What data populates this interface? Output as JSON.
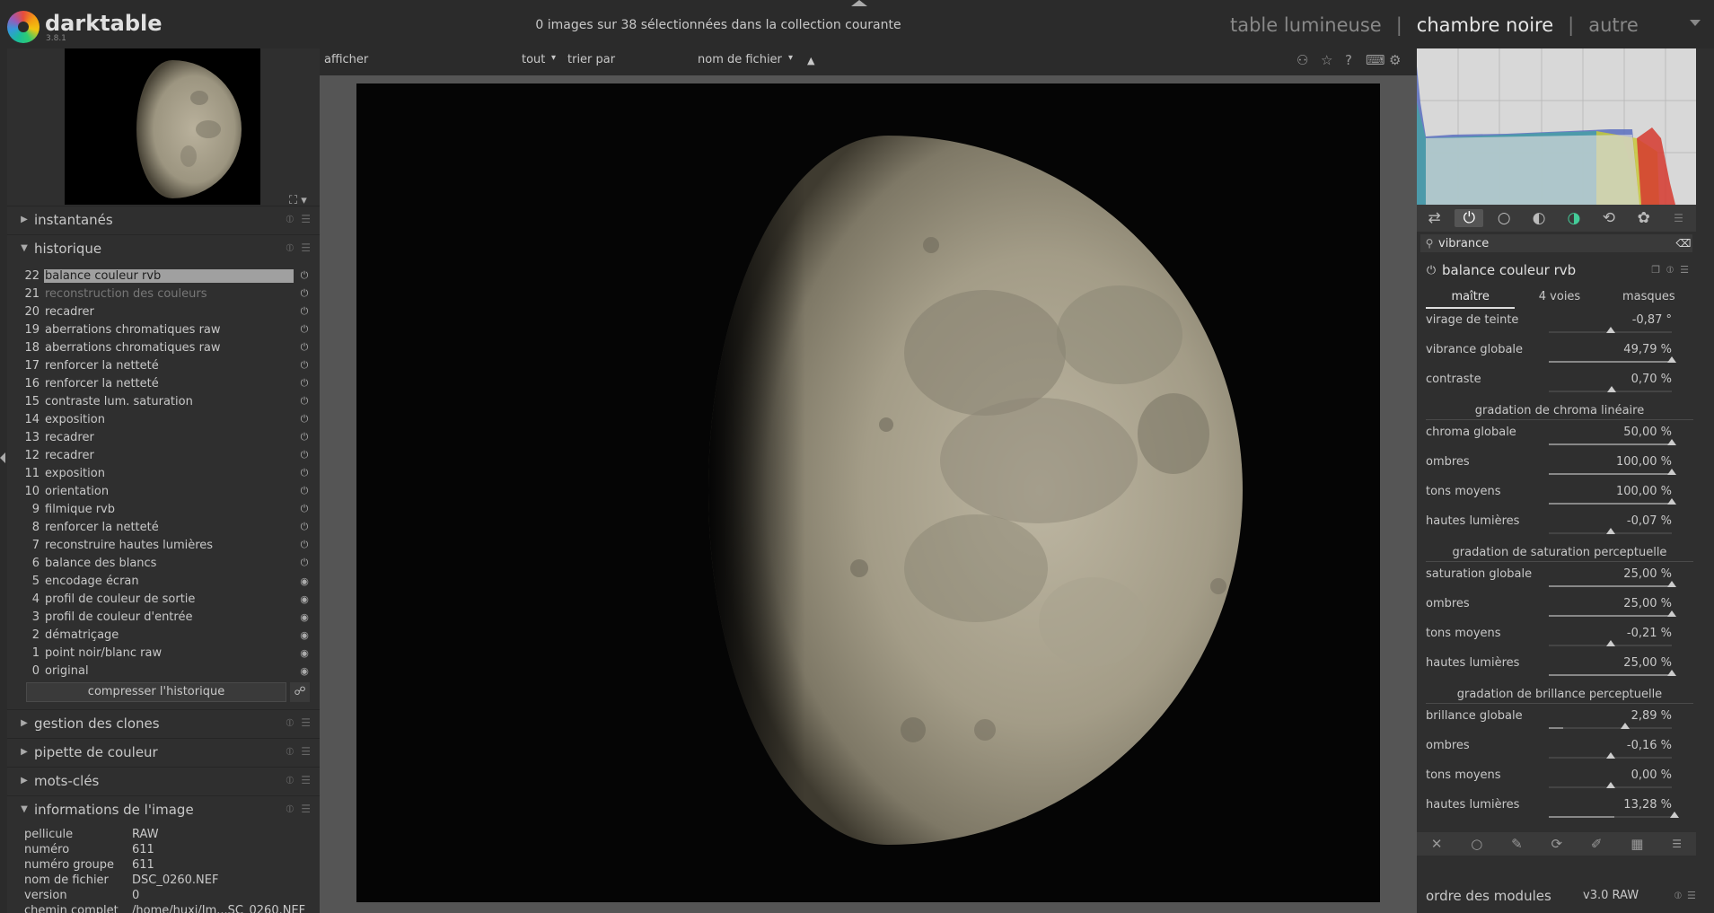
{
  "app": {
    "title": "darktable",
    "version": "3.8.1"
  },
  "header": {
    "collection_status": "0 images sur 38 sélectionnées dans la collection courante",
    "views": {
      "lighttable": "table lumineuse",
      "darkroom": "chambre noire",
      "other": "autre",
      "separator": "|"
    }
  },
  "toolbar": {
    "show_label": "afficher",
    "filter_value": "tout",
    "sort_label": "trier par",
    "sort_value": "nom de fichier",
    "sort_direction_icon": "▲",
    "dropdown_icon": "▾"
  },
  "left_panel": {
    "snapshots": {
      "label": "instantanés"
    },
    "history": {
      "label": "historique",
      "items": [
        {
          "num": "22",
          "label": "balance couleur rvb",
          "state": "selected",
          "icon": "power-icon"
        },
        {
          "num": "21",
          "label": "reconstruction des couleurs",
          "state": "disabled",
          "icon": "power-icon"
        },
        {
          "num": "20",
          "label": "recadrer",
          "state": "normal",
          "icon": "power-icon"
        },
        {
          "num": "19",
          "label": "aberrations chromatiques raw",
          "state": "normal",
          "icon": "power-icon"
        },
        {
          "num": "18",
          "label": "aberrations chromatiques raw",
          "state": "normal",
          "icon": "power-icon"
        },
        {
          "num": "17",
          "label": "renforcer la netteté",
          "state": "normal",
          "icon": "power-icon"
        },
        {
          "num": "16",
          "label": "renforcer la netteté",
          "state": "normal",
          "icon": "power-icon"
        },
        {
          "num": "15",
          "label": "contraste lum. saturation",
          "state": "normal",
          "icon": "power-icon"
        },
        {
          "num": "14",
          "label": "exposition",
          "state": "normal",
          "icon": "power-icon"
        },
        {
          "num": "13",
          "label": "recadrer",
          "state": "normal",
          "icon": "power-icon"
        },
        {
          "num": "12",
          "label": "recadrer",
          "state": "normal",
          "icon": "power-icon"
        },
        {
          "num": "11",
          "label": "exposition",
          "state": "normal",
          "icon": "power-icon"
        },
        {
          "num": "10",
          "label": "orientation",
          "state": "normal",
          "icon": "power-icon"
        },
        {
          "num": "9",
          "label": "filmique rvb",
          "state": "normal",
          "icon": "power-icon"
        },
        {
          "num": "8",
          "label": "renforcer la netteté",
          "state": "normal",
          "icon": "power-icon"
        },
        {
          "num": "7",
          "label": "reconstruire hautes lumières",
          "state": "normal",
          "icon": "power-icon"
        },
        {
          "num": "6",
          "label": "balance des blancs",
          "state": "normal",
          "icon": "power-icon"
        },
        {
          "num": "5",
          "label": "encodage écran",
          "state": "normal",
          "icon": "always-on-icon"
        },
        {
          "num": "4",
          "label": "profil de couleur de sortie",
          "state": "normal",
          "icon": "always-on-icon"
        },
        {
          "num": "3",
          "label": "profil de couleur d'entrée",
          "state": "normal",
          "icon": "always-on-icon"
        },
        {
          "num": "2",
          "label": "dématriçage",
          "state": "normal",
          "icon": "always-on-icon"
        },
        {
          "num": "1",
          "label": "point noir/blanc raw",
          "state": "normal",
          "icon": "always-on-icon"
        },
        {
          "num": "0",
          "label": "original",
          "state": "normal",
          "icon": "always-on-icon"
        }
      ],
      "compress_label": "compresser l'historique"
    },
    "duplicate_manager": {
      "label": "gestion des clones"
    },
    "color_picker": {
      "label": "pipette de couleur"
    },
    "tagging": {
      "label": "mots-clés"
    },
    "image_info": {
      "label": "informations de l'image",
      "rows": [
        {
          "key": "pellicule",
          "value": "RAW"
        },
        {
          "key": "numéro",
          "value": "611"
        },
        {
          "key": "numéro groupe",
          "value": "611"
        },
        {
          "key": "nom de fichier",
          "value": "DSC_0260.NEF"
        },
        {
          "key": "version",
          "value": "0"
        },
        {
          "key": "chemin complet",
          "value": "/home/huxi/Im...SC_0260.NEF"
        }
      ]
    }
  },
  "right_panel": {
    "search_value": "vibrance",
    "module": {
      "title": "balance couleur rvb",
      "tabs": [
        "maître",
        "4 voies",
        "masques"
      ],
      "active_tab": 0,
      "rows": [
        {
          "type": "slider",
          "label": "virage de teinte",
          "value": "-0,87 °",
          "fill": 0.0,
          "handle": 0.5
        },
        {
          "type": "slider",
          "label": "vibrance globale",
          "value": "49,79 %",
          "fill": 1.0,
          "handle": 1.0
        },
        {
          "type": "slider",
          "label": "contraste",
          "value": "0,70 %",
          "fill": 0.0,
          "handle": 0.51
        },
        {
          "type": "section",
          "label": "gradation de chroma linéaire"
        },
        {
          "type": "slider",
          "label": "chroma globale",
          "value": "50,00 %",
          "fill": 1.0,
          "handle": 1.0
        },
        {
          "type": "slider",
          "label": "ombres",
          "value": "100,00 %",
          "fill": 1.0,
          "handle": 1.0
        },
        {
          "type": "slider",
          "label": "tons moyens",
          "value": "100,00 %",
          "fill": 1.0,
          "handle": 1.0
        },
        {
          "type": "slider",
          "label": "hautes lumières",
          "value": "-0,07 %",
          "fill": 0.0,
          "handle": 0.5
        },
        {
          "type": "section",
          "label": "gradation de saturation perceptuelle"
        },
        {
          "type": "slider",
          "label": "saturation globale",
          "value": "25,00 %",
          "fill": 1.0,
          "handle": 1.0
        },
        {
          "type": "slider",
          "label": "ombres",
          "value": "25,00 %",
          "fill": 1.0,
          "handle": 1.0
        },
        {
          "type": "slider",
          "label": "tons moyens",
          "value": "-0,21 %",
          "fill": 0.0,
          "handle": 0.5
        },
        {
          "type": "slider",
          "label": "hautes lumières",
          "value": "25,00 %",
          "fill": 1.0,
          "handle": 1.0
        },
        {
          "type": "section",
          "label": "gradation de brillance perceptuelle"
        },
        {
          "type": "slider",
          "label": "brillance globale",
          "value": "2,89 %",
          "fill": 0.12,
          "handle": 0.62
        },
        {
          "type": "slider",
          "label": "ombres",
          "value": "-0,16 %",
          "fill": 0.0,
          "handle": 0.5
        },
        {
          "type": "slider",
          "label": "tons moyens",
          "value": "0,00 %",
          "fill": 0.0,
          "handle": 0.5
        },
        {
          "type": "slider",
          "label": "hautes lumières",
          "value": "13,28 %",
          "fill": 0.53,
          "handle": 1.03
        }
      ]
    },
    "module_order": {
      "label": "ordre des modules",
      "value": "v3.0 RAW"
    }
  }
}
